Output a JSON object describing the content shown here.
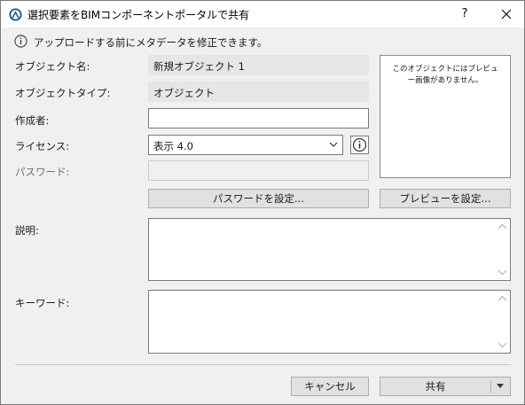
{
  "window": {
    "title": "選択要素をBIMコンポーネントポータルで共有",
    "help_label": "?"
  },
  "info": {
    "message": "アップロードする前にメタデータを修正できます。"
  },
  "form": {
    "object_name_label": "オブジェクト名:",
    "object_name_value": "新規オブジェクト 1",
    "object_type_label": "オブジェクトタイプ:",
    "object_type_value": "オブジェクト",
    "author_label": "作成者:",
    "author_value": "",
    "license_label": "ライセンス:",
    "license_value": "表示 4.0",
    "password_label": "パスワード:",
    "password_value": "",
    "set_password_button": "パスワードを設定...",
    "description_label": "説明:",
    "keywords_label": "キーワード:"
  },
  "preview": {
    "empty_text": "このオブジェクトにはプレビュー画像がありません。",
    "set_preview_button": "プレビューを設定..."
  },
  "footer": {
    "cancel_button": "キャンセル",
    "share_button": "共有"
  },
  "icons": {
    "app": "archicad-app-icon",
    "info": "info-icon",
    "close": "close-icon",
    "dropdown": "chevron-down-icon",
    "license_info": "info-icon",
    "scroll_up": "scroll-up-icon",
    "scroll_down": "scroll-down-icon",
    "split_dropdown": "caret-down-icon"
  },
  "colors": {
    "dialog_bg": "#f0f0f0",
    "readonly_field_bg": "#e6e6e6",
    "button_bg": "#e1e1e1",
    "border": "#7a7a7a"
  }
}
